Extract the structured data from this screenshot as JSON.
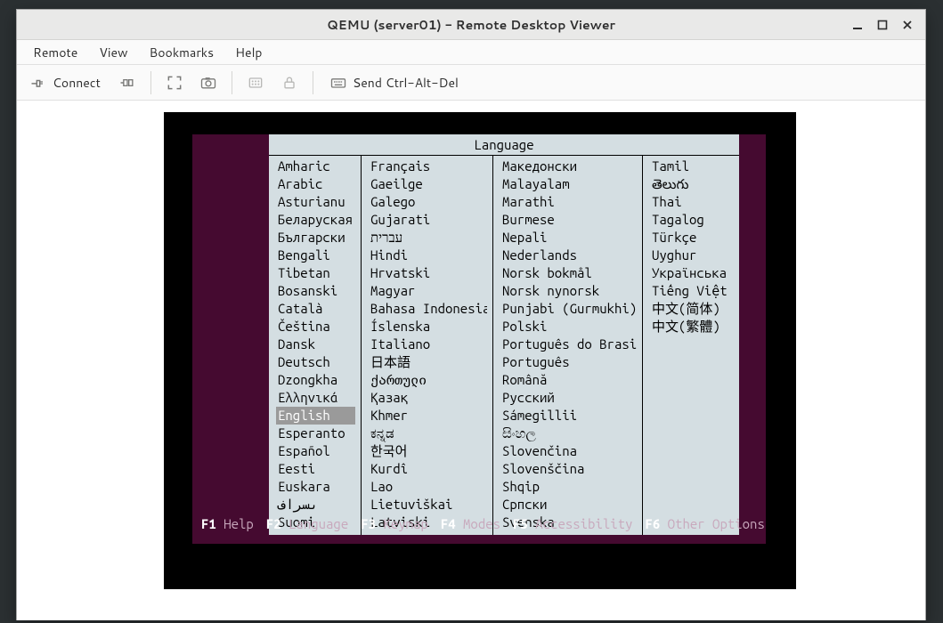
{
  "window": {
    "title": "QEMU (server01) - Remote Desktop Viewer"
  },
  "menubar": {
    "remote": "Remote",
    "view": "View",
    "bookmarks": "Bookmarks",
    "help": "Help"
  },
  "toolbar": {
    "connect": "Connect",
    "send_cad": "Send Ctrl-Alt-Del"
  },
  "installer": {
    "title": "Language",
    "selected": "English",
    "columns": [
      [
        "Amharic",
        "Arabic",
        "Asturianu",
        "Беларуская",
        "Български",
        "Bengali",
        "Tibetan",
        "Bosanski",
        "Català",
        "Čeština",
        "Dansk",
        "Deutsch",
        "Dzongkha",
        "Ελληνικά",
        "English",
        "Esperanto",
        "Español",
        "Eesti",
        "Euskara",
        "ىسراف",
        "Suomi"
      ],
      [
        "Français",
        "Gaeilge",
        "Galego",
        "Gujarati",
        "עברית",
        "Hindi",
        "Hrvatski",
        "Magyar",
        "Bahasa Indonesia",
        "Íslenska",
        "Italiano",
        "日本語",
        "ქართული",
        "Қазақ",
        "Khmer",
        "ಕನ್ನಡ",
        "한국어",
        "Kurdî",
        "Lao",
        "Lietuviškai",
        "Latviski"
      ],
      [
        "Македонски",
        "Malayalam",
        "Marathi",
        "Burmese",
        "Nepali",
        "Nederlands",
        "Norsk bokmål",
        "Norsk nynorsk",
        "Punjabi (Gurmukhi)",
        "Polski",
        "Português do Brasil",
        "Português",
        "Română",
        "Русский",
        "Sámegillii",
        "සිංහල",
        "Slovenčina",
        "Slovenščina",
        "Shqip",
        "Српски",
        "Svenska"
      ],
      [
        "Tamil",
        "తెలుగు",
        "Thai",
        "Tagalog",
        "Türkçe",
        "Uyghur",
        "Українська",
        "Tiếng Việt",
        "中文(简体)",
        "中文(繁體)"
      ]
    ],
    "fkeys": [
      {
        "key": "F1",
        "label": "Help"
      },
      {
        "key": "F2",
        "label": "Language"
      },
      {
        "key": "F3",
        "label": "Keymap"
      },
      {
        "key": "F4",
        "label": "Modes"
      },
      {
        "key": "F5",
        "label": "Accessibility"
      },
      {
        "key": "F6",
        "label": "Other Options"
      }
    ]
  }
}
